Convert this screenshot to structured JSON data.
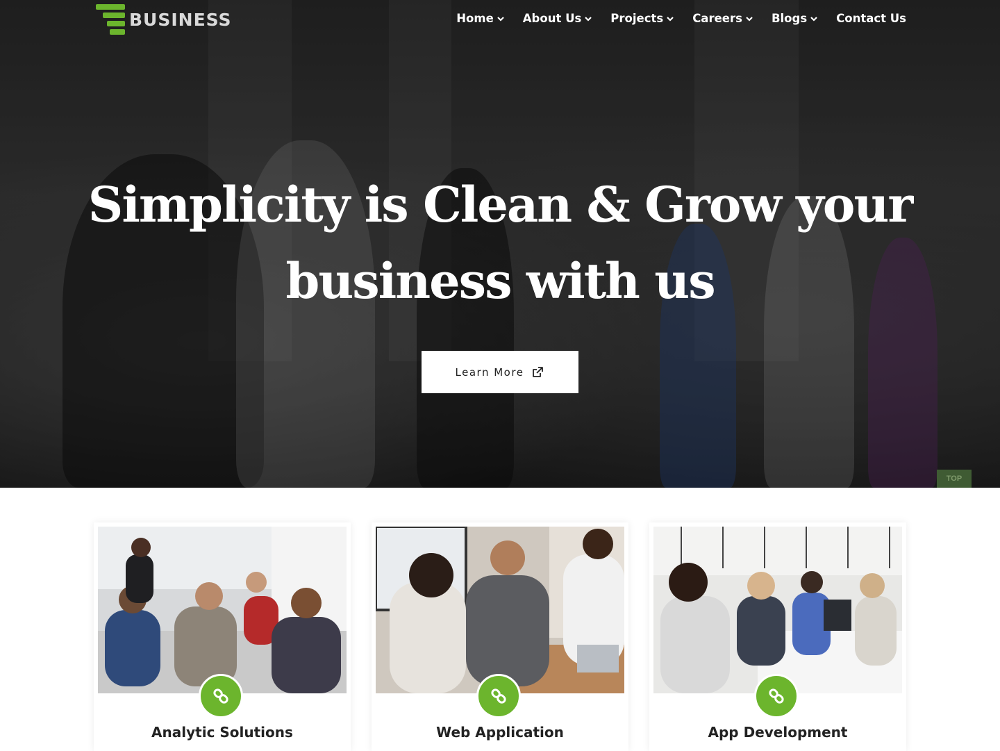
{
  "brand": {
    "name": "BUSINESS",
    "accent": "#6cb52d",
    "icon": "stacked-bars-logo-icon"
  },
  "nav": {
    "items": [
      {
        "label": "Home",
        "icon": "chevron-down-icon"
      },
      {
        "label": "About Us",
        "icon": "chevron-down-icon"
      },
      {
        "label": "Projects",
        "icon": "chevron-down-icon"
      },
      {
        "label": "Careers",
        "icon": "chevron-down-icon"
      },
      {
        "label": "Blogs",
        "icon": "chevron-down-icon"
      },
      {
        "label": "Contact Us"
      }
    ]
  },
  "hero": {
    "headline_line1": "Simplicity is Clean & Grow your",
    "headline_line2": "business with us",
    "cta_label": "Learn More",
    "cta_icon": "external-link-icon"
  },
  "scroll_top": {
    "label": "TOP"
  },
  "cards": [
    {
      "title": "Analytic Solutions",
      "icon": "link-icon"
    },
    {
      "title": "Web Application",
      "icon": "link-icon"
    },
    {
      "title": "App Development",
      "icon": "link-icon"
    }
  ]
}
